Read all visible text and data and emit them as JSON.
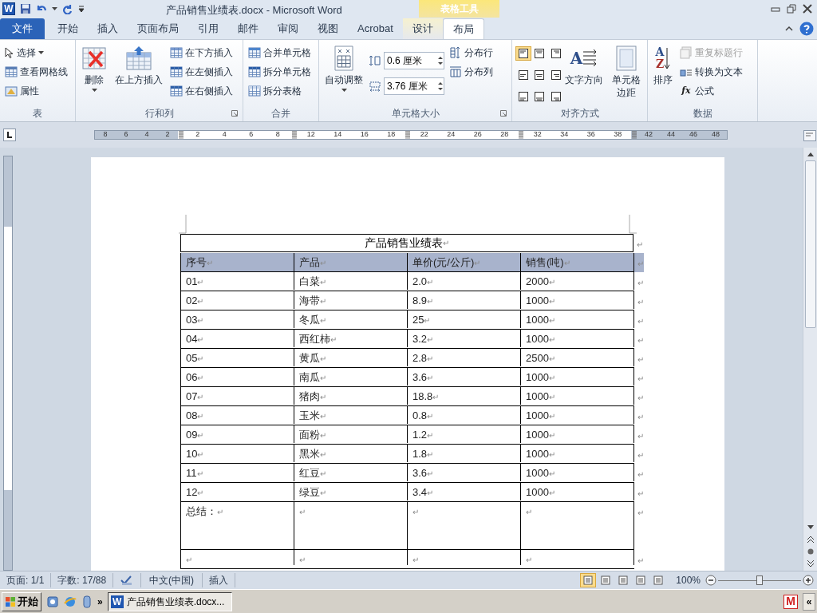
{
  "title_bar": {
    "app_icon": "W",
    "title": "产品销售业绩表.docx - Microsoft Word",
    "contextual_label": "表格工具"
  },
  "tabs": [
    {
      "label": "文件",
      "kind": "file",
      "selected": false
    },
    {
      "label": "开始",
      "kind": "normal",
      "selected": false
    },
    {
      "label": "插入",
      "kind": "normal",
      "selected": false
    },
    {
      "label": "页面布局",
      "kind": "normal",
      "selected": false
    },
    {
      "label": "引用",
      "kind": "normal",
      "selected": false
    },
    {
      "label": "邮件",
      "kind": "normal",
      "selected": false
    },
    {
      "label": "审阅",
      "kind": "normal",
      "selected": false
    },
    {
      "label": "视图",
      "kind": "normal",
      "selected": false
    },
    {
      "label": "Acrobat",
      "kind": "normal",
      "selected": false
    },
    {
      "label": "设计",
      "kind": "contextual",
      "selected": false
    },
    {
      "label": "布局",
      "kind": "contextual",
      "selected": true
    }
  ],
  "ribbon": [
    {
      "label": "表",
      "launcher": false,
      "items": [
        {
          "kind": "column",
          "buttons": [
            {
              "label": "选择",
              "dropdown": true,
              "disabled": false
            },
            {
              "label": "查看网格线",
              "dropdown": false,
              "disabled": false
            },
            {
              "label": "属性",
              "dropdown": false,
              "disabled": false
            }
          ]
        }
      ]
    },
    {
      "label": "行和列",
      "launcher": true,
      "items": [
        {
          "kind": "large",
          "label": "删除",
          "dropdown": true
        },
        {
          "kind": "large",
          "label": "在上方插入",
          "dropdown": false
        },
        {
          "kind": "column",
          "buttons": [
            {
              "label": "在下方插入",
              "dropdown": false,
              "disabled": false
            },
            {
              "label": "在左侧插入",
              "dropdown": false,
              "disabled": false
            },
            {
              "label": "在右侧插入",
              "dropdown": false,
              "disabled": false
            }
          ]
        }
      ]
    },
    {
      "label": "合并",
      "launcher": false,
      "items": [
        {
          "kind": "column",
          "buttons": [
            {
              "label": "合并单元格",
              "dropdown": false,
              "disabled": false
            },
            {
              "label": "拆分单元格",
              "dropdown": false,
              "disabled": false
            },
            {
              "label": "拆分表格",
              "dropdown": false,
              "disabled": false
            }
          ]
        }
      ]
    },
    {
      "label": "单元格大小",
      "launcher": true,
      "items": [
        {
          "kind": "large",
          "label": "自动调整",
          "dropdown": true
        },
        {
          "kind": "spin_column",
          "fields": [
            {
              "value": "0.6 厘米"
            },
            {
              "value": "3.76 厘米"
            }
          ]
        },
        {
          "kind": "column",
          "buttons": [
            {
              "label": "分布行",
              "dropdown": false,
              "disabled": false
            },
            {
              "label": "分布列",
              "dropdown": false,
              "disabled": false
            }
          ]
        }
      ]
    },
    {
      "label": "对齐方式",
      "launcher": false,
      "items": [
        {
          "kind": "align_grid",
          "cells": [
            {
              "selected": true
            },
            {
              "selected": false
            },
            {
              "selected": false
            },
            {
              "selected": false
            },
            {
              "selected": false
            },
            {
              "selected": false
            },
            {
              "selected": false
            },
            {
              "selected": false
            },
            {
              "selected": false
            }
          ]
        },
        {
          "kind": "large",
          "label": "文字方向",
          "dropdown": false,
          "icon_text": "A"
        },
        {
          "kind": "large",
          "label": "单元格边距",
          "dropdown": false
        }
      ]
    },
    {
      "label": "数据",
      "launcher": false,
      "items": [
        {
          "kind": "large",
          "label": "排序",
          "dropdown": false,
          "icon_letters": [
            "A",
            "Z"
          ]
        },
        {
          "kind": "column",
          "buttons": [
            {
              "label": "重复标题行",
              "dropdown": false,
              "disabled": true
            },
            {
              "label": "转换为文本",
              "dropdown": false,
              "disabled": false
            },
            {
              "label": "公式",
              "dropdown": false,
              "disabled": false,
              "icon_text": "fx"
            }
          ]
        }
      ]
    }
  ],
  "ruler": {
    "segments": [
      {
        "shaded": true,
        "labels": [
          "8",
          "6",
          "4",
          "2"
        ]
      },
      {
        "shaded": false,
        "labels": [
          "2",
          "4",
          "6",
          "8"
        ]
      },
      {
        "shaded": false,
        "labels": [
          "12",
          "14",
          "16",
          "18"
        ]
      },
      {
        "shaded": false,
        "labels": [
          "22",
          "24",
          "26",
          "28"
        ]
      },
      {
        "shaded": false,
        "labels": [
          "32",
          "34",
          "36",
          "38"
        ]
      },
      {
        "shaded": true,
        "labels": [
          "42",
          "44",
          "46",
          "48"
        ]
      }
    ]
  },
  "document": {
    "paragraph_mark": "↵",
    "table": {
      "title": "产品销售业绩表",
      "header": {
        "selected": true,
        "cells": [
          "序号",
          "产品",
          "单价(元/公斤)",
          "销售(吨)"
        ]
      },
      "rows": [
        {
          "kind": "data",
          "cells": [
            "01",
            "白菜",
            "2.0",
            "2000"
          ]
        },
        {
          "kind": "data",
          "cells": [
            "02",
            "海带",
            "8.9",
            "1000"
          ]
        },
        {
          "kind": "data",
          "cells": [
            "03",
            "冬瓜",
            "25",
            "1000"
          ]
        },
        {
          "kind": "data",
          "cells": [
            "04",
            "西红柿",
            "3.2",
            "1000"
          ]
        },
        {
          "kind": "data",
          "cells": [
            "05",
            "黄瓜",
            "2.8",
            "2500"
          ]
        },
        {
          "kind": "data",
          "cells": [
            "06",
            "南瓜",
            "3.6",
            "1000"
          ]
        },
        {
          "kind": "data",
          "cells": [
            "07",
            "猪肉",
            "18.8",
            "1000"
          ]
        },
        {
          "kind": "data",
          "cells": [
            "08",
            "玉米",
            "0.8",
            "1000"
          ]
        },
        {
          "kind": "data",
          "cells": [
            "09",
            "面粉",
            "1.2",
            "1000"
          ]
        },
        {
          "kind": "data",
          "cells": [
            "10",
            "黑米",
            "1.8",
            "1000"
          ]
        },
        {
          "kind": "data",
          "cells": [
            "11",
            "红豆",
            "3.6",
            "1000"
          ]
        },
        {
          "kind": "data",
          "cells": [
            "12",
            "绿豆",
            "3.4",
            "1000"
          ]
        },
        {
          "kind": "summary",
          "cells": [
            "总结："
          ]
        },
        {
          "kind": "blank"
        }
      ]
    }
  },
  "status_bar": {
    "page": "页面: 1/1",
    "words": "字数: 17/88",
    "language": "中文(中国)",
    "mode": "插入",
    "views": [
      {
        "selected": true
      },
      {
        "selected": false
      },
      {
        "selected": false
      },
      {
        "selected": false
      },
      {
        "selected": false
      }
    ],
    "zoom": "100%",
    "zoom_slider": {
      "level": 0.5
    }
  },
  "taskbar": {
    "start": "开始",
    "chevron": "»",
    "app_icon": "W",
    "task": "产品销售业绩表.docx...",
    "tray_icon": "M",
    "tray_chevron": "«"
  }
}
